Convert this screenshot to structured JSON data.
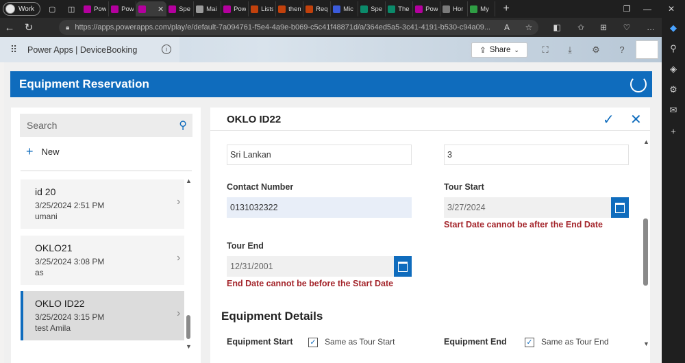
{
  "browser": {
    "profile_label": "Work",
    "tabs": [
      {
        "label": "Pow",
        "color": "#b4009e"
      },
      {
        "label": "Pow",
        "color": "#b4009e"
      },
      {
        "label": "",
        "color": "#b4009e"
      },
      {
        "label": "Spe",
        "color": "#b4009e"
      },
      {
        "label": "Mai",
        "color": "#9a9a9a"
      },
      {
        "label": "Pow",
        "color": "#b4009e"
      },
      {
        "label": "Lists",
        "color": "#c2410c"
      },
      {
        "label": "then",
        "color": "#c2410c"
      },
      {
        "label": "Req",
        "color": "#c2410c"
      },
      {
        "label": "Mic",
        "color": "#3b5bdb"
      },
      {
        "label": "Spe",
        "color": "#0b8a6a"
      },
      {
        "label": "The",
        "color": "#0b8a6a"
      },
      {
        "label": "Pow",
        "color": "#b4009e"
      },
      {
        "label": "Hor",
        "color": "#7a7a7a"
      },
      {
        "label": "My",
        "color": "#2f9e44"
      }
    ],
    "url": "https://apps.powerapps.com/play/e/default-7a094761-f5e4-4a9e-b069-c5c41f48871d/a/364ed5a5-3c41-4191-b530-c94a09..."
  },
  "header": {
    "app_title": "Power Apps  |  DeviceBooking",
    "share_label": "Share"
  },
  "banner": {
    "title": "Equipment Reservation"
  },
  "gallery": {
    "search_placeholder": "Search",
    "new_label": "New",
    "items": [
      {
        "name": "id 20",
        "date": "3/25/2024 2:51 PM",
        "user": "umani"
      },
      {
        "name": "OKLO21",
        "date": "3/25/2024 3:08 PM",
        "user": "as"
      },
      {
        "name": "OKLO ID22",
        "date": "3/25/2024 3:15 PM",
        "user": "test Amila"
      }
    ]
  },
  "form": {
    "title": "OKLO ID22",
    "field_top_left": "Sri Lankan",
    "field_top_right": "3",
    "contact_label": "Contact Number",
    "contact_value": "0131032322",
    "tour_start_label": "Tour Start",
    "tour_start_value": "3/27/2024",
    "tour_start_error": "Start Date cannot be after the End Date",
    "tour_end_label": "Tour End",
    "tour_end_value": "12/31/2001",
    "tour_end_error": "End Date cannot be before the Start Date",
    "section_title": "Equipment Details",
    "equipment_start_label": "Equipment Start",
    "equipment_start_check": "Same as Tour Start",
    "equipment_end_label": "Equipment End",
    "equipment_end_check": "Same as Tour End"
  }
}
